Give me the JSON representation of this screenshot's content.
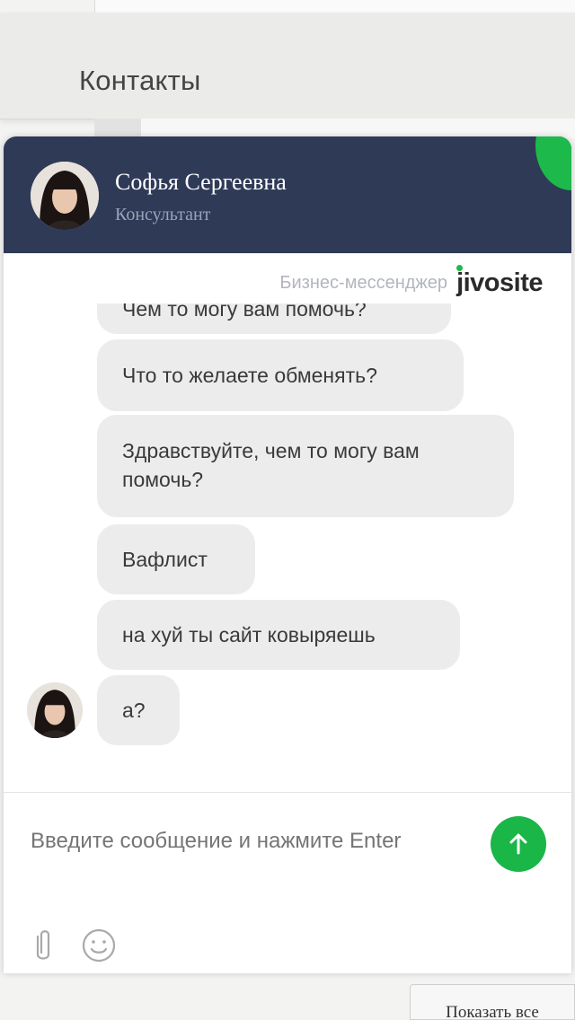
{
  "background": {
    "contacts_label": "Контакты",
    "show_all_button": "Показать все"
  },
  "chat": {
    "header": {
      "agent_name": "Софья Сергеевна",
      "agent_role": "Консультант",
      "accent_color": "#1db94a",
      "header_color": "#2f3a57"
    },
    "branding": {
      "caption": "Бизнес-мессенджер",
      "logo": "jivosite"
    },
    "messages": [
      "Чем то могу вам помочь?",
      "Что то желаете обменять?",
      "Здравствуйте, чем то могу вам помочь?",
      "Вафлист",
      "на хуй ты сайт ковыряешь",
      "а?"
    ],
    "input": {
      "placeholder": "Введите сообщение и нажмите Enter"
    },
    "icons": {
      "send": "arrow-up-icon",
      "attach": "paperclip-icon",
      "emoji": "smiley-icon"
    }
  }
}
